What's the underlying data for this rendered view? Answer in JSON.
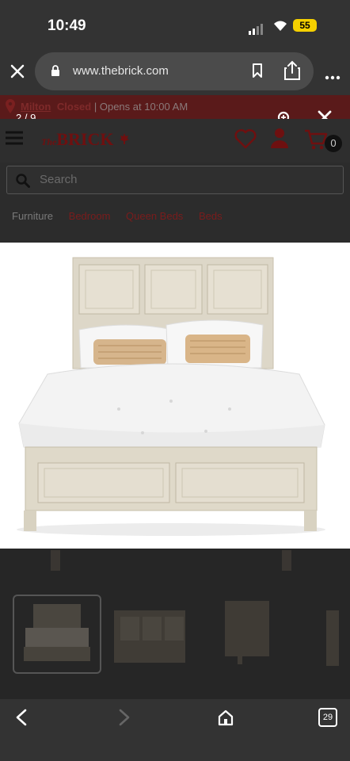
{
  "status_bar": {
    "time": "10:49",
    "battery": "55"
  },
  "browser": {
    "url": "www.thebrick.com",
    "tabs_count": "29"
  },
  "site": {
    "store_name": "Milton",
    "store_status": "Closed",
    "store_hours": "| Opens at 10:00 AM",
    "logo_prefix": "The",
    "logo_name": "BRICK",
    "cart_count": "0",
    "search_placeholder": "Search",
    "breadcrumbs": [
      "Furniture",
      "Bedroom",
      "Queen Beds",
      "Beds"
    ]
  },
  "viewer": {
    "counter": "2 / 9"
  },
  "colors": {
    "accent_red": "#c8102e",
    "battery_yellow": "#f5d000"
  }
}
